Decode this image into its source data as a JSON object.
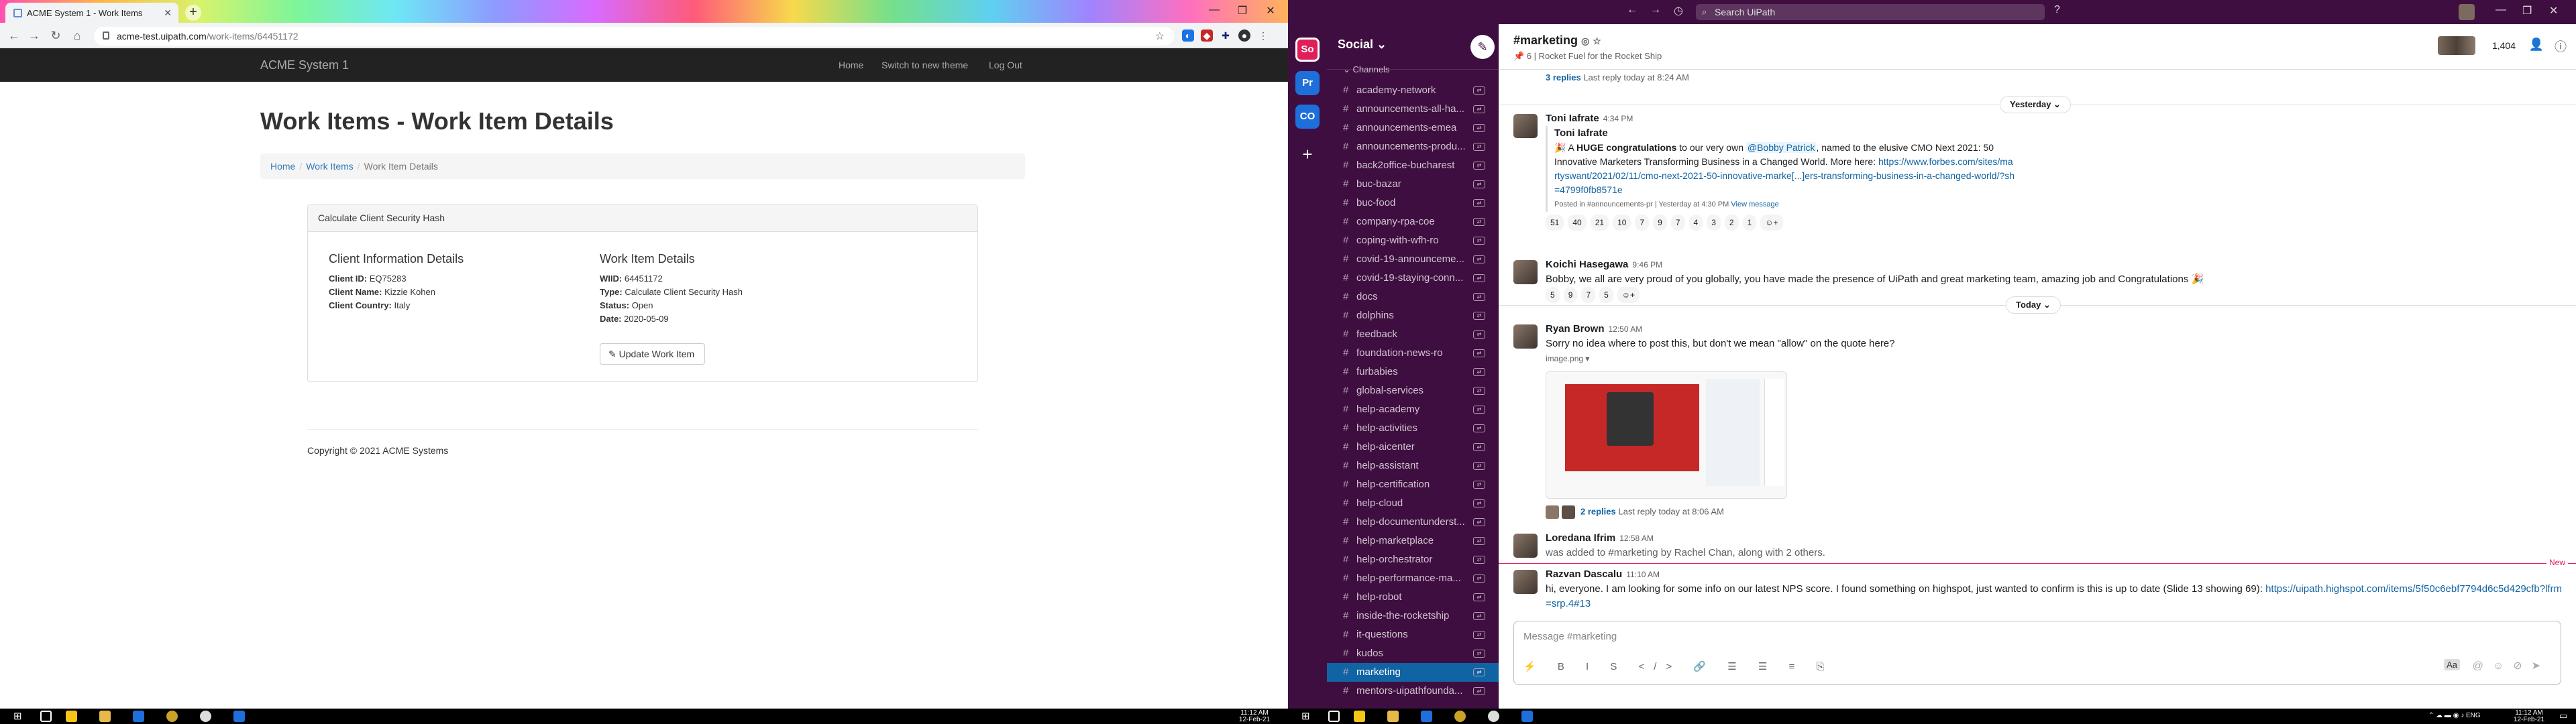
{
  "chrome": {
    "tab_title": "ACME System 1 - Work Items",
    "tab_close": "✕",
    "new_tab": "+",
    "url_host": "acme-test.uipath.com",
    "url_path": "/work-items/64451172"
  },
  "acme": {
    "brand": "ACME System 1",
    "nav": [
      "Home",
      "Switch to new theme",
      "Log Out"
    ],
    "page_title": "Work Items - Work Item Details",
    "breadcrumb": [
      "Home",
      "Work Items",
      "Work Item Details"
    ],
    "panel_title": "Calculate Client Security Hash",
    "client_heading": "Client Information Details",
    "client": {
      "id_label": "Client ID:",
      "id": "EQ75283",
      "name_label": "Client Name:",
      "name": "Kizzie Kohen",
      "country_label": "Client Country:",
      "country": "Italy"
    },
    "work_heading": "Work Item Details",
    "work": {
      "wiid_label": "WIID:",
      "wiid": "64451172",
      "type_label": "Type:",
      "type": "Calculate Client Security Hash",
      "status_label": "Status:",
      "status": "Open",
      "date_label": "Date:",
      "date": "2020-05-09"
    },
    "update_button": "Update Work Item",
    "copyright": "Copyright © 2021 ACME Systems"
  },
  "slack": {
    "search_placeholder": "Search UiPath",
    "workspaces": [
      "So",
      "Pr",
      "CO"
    ],
    "workspace_name": "Social",
    "section": "Channels",
    "channels": [
      "academy-network",
      "announcements-all-ha...",
      "announcements-emea",
      "announcements-produ...",
      "back2office-bucharest",
      "buc-bazar",
      "buc-food",
      "company-rpa-coe",
      "coping-with-wfh-ro",
      "covid-19-announceme...",
      "covid-19-staying-conn...",
      "docs",
      "dolphins",
      "feedback",
      "foundation-news-ro",
      "furbabies",
      "global-services",
      "help-academy",
      "help-activities",
      "help-aicenter",
      "help-assistant",
      "help-certification",
      "help-cloud",
      "help-documentunderst...",
      "help-marketplace",
      "help-orchestrator",
      "help-performance-ma...",
      "help-robot",
      "inside-the-rocketship",
      "it-questions",
      "kudos",
      "marketing",
      "mentors-uipathfounda..."
    ],
    "active_channel": "marketing",
    "channel_title": "#marketing",
    "channel_members_small": "6",
    "channel_topic": "Rocket Fuel for the Rocket Ship",
    "member_count": "1,404",
    "top_thread": {
      "replies": "3 replies",
      "last": "Last reply today at 8:24 AM"
    },
    "day_yesterday": "Yesterday",
    "day_today": "Today",
    "messages": [
      {
        "author": "Toni Iafrate",
        "time": "4:34 PM",
        "shared_author": "Toni Iafrate",
        "pre": "🎉 A ",
        "bold": "HUGE congratulations",
        "mid": " to our very own ",
        "mention": "@Bobby Patrick",
        "post": ", named to the elusive CMO Next 2021: 50 Innovative Marketers Transforming Business in a Changed World. More here: ",
        "link": "https://www.forbes.com/sites/martyswant/2021/02/11/cmo-next-2021-50-innovative-marke[...]ers-transforming-business-in-a-changed-world/?sh=4799f0fb8571e",
        "posted": "Posted in #announcements-pr | Yesterday at 4:30 PM",
        "view": "View message",
        "reactions": [
          "51",
          "40",
          "21",
          "10",
          "7",
          "9",
          "7",
          "4",
          "3",
          "2",
          "1"
        ]
      },
      {
        "author": "Koichi Hasegawa",
        "time": "9:46 PM",
        "text": "Bobby, we all are very proud of you globally, you have made the presence of UiPath and great marketing team, amazing job and Congratulations 🎉",
        "reactions": [
          "5",
          "9",
          "7",
          "5"
        ]
      },
      {
        "author": "Ryan Brown",
        "time": "12:50 AM",
        "text": "Sorry no idea where to post this, but don't we mean \"allow\" on the quote here?",
        "file": "image.png",
        "replies": "2 replies",
        "last": "Last reply today at 8:06 AM"
      },
      {
        "author": "Loredana Ifrim",
        "time": "12:58 AM",
        "text": "was added to #marketing by Rachel Chan, along with 2 others."
      },
      {
        "author": "Razvan Dascalu",
        "time": "11:10 AM",
        "text": "hi, everyone. I am looking for some info on our latest NPS score. I found something on highspot, just wanted to confirm is this is up to date (Slide 13 showing 69): ",
        "link": "https://uipath.highspot.com/items/5f50c6ebf7794d6c5d429cfb?lfrm=srp.4#13"
      }
    ],
    "new_label": "New",
    "composer_placeholder": "Message #marketing",
    "composer_tools": "⚡ B I S </> 🔗 ☰ ☰ ≡ ⎘"
  },
  "taskbar": {
    "left_time": "11:12 AM",
    "left_date": "12-Feb-21",
    "right_time": "11:12 AM",
    "right_date": "12-Feb-21",
    "lang": "ENG"
  }
}
